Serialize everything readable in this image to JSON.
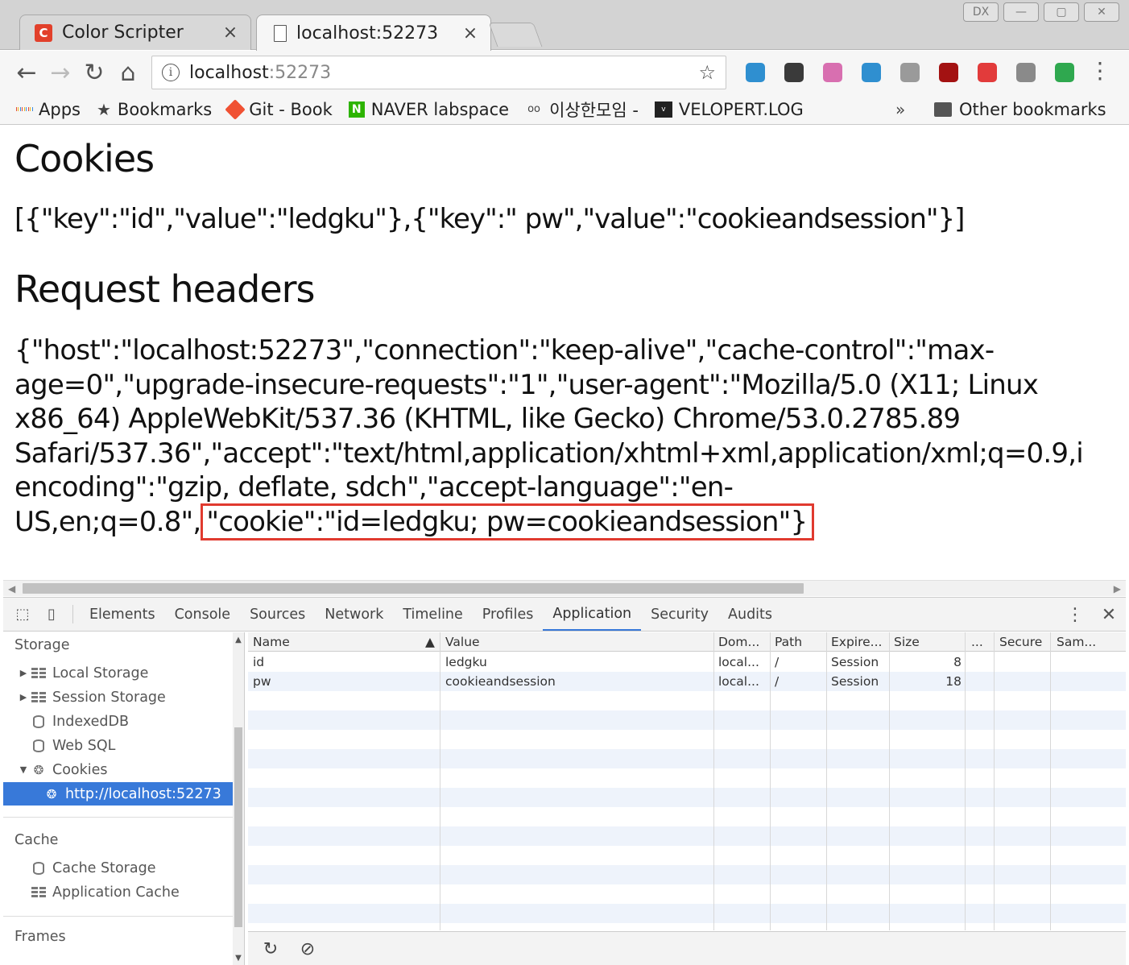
{
  "window": {
    "tabs": [
      {
        "title": "Color Scripter",
        "favicon": "C",
        "close": "×"
      },
      {
        "title": "localhost:52273",
        "close": "×"
      }
    ],
    "buttons": {
      "dx": "DX",
      "minimize": "—",
      "maximize": "▢",
      "close": "✕"
    }
  },
  "toolbar": {
    "url_host": "localhost",
    "url_port": ":52273",
    "back_icon": "←",
    "forward_icon": "→",
    "reload_icon": "↻",
    "home_icon": "⌂",
    "star_icon": "☆",
    "menu_icon": "⋮",
    "extensions": [
      {
        "name": "globe-extension",
        "color": "#2f8fd0"
      },
      {
        "name": "evernote-extension",
        "color": "#3a3a3a"
      },
      {
        "name": "gallery-extension",
        "color": "#d86fb0"
      },
      {
        "name": "globe2-extension",
        "color": "#2f8fd0"
      },
      {
        "name": "screen-extension",
        "color": "#9a9a9a"
      },
      {
        "name": "ublock-extension",
        "color": "#a31212"
      },
      {
        "name": "media-extension",
        "color": "#e23b3b"
      },
      {
        "name": "list-extension",
        "color": "#8a8a8a"
      },
      {
        "name": "green-circle-extension",
        "color": "#2fa84f"
      }
    ]
  },
  "bookmarks": {
    "items": [
      "Apps",
      "Bookmarks",
      "Git - Book",
      "NAVER labspace",
      "이상한모임 -",
      "VELOPERT.LOG"
    ],
    "naver_letter": "N",
    "velo_letter": "v",
    "more": "»",
    "other": "Other bookmarks"
  },
  "page": {
    "cookies_heading": "Cookies",
    "cookies_json": "[{\"key\":\"id\",\"value\":\"ledgku\"},{\"key\":\" pw\",\"value\":\"cookieandsession\"}]",
    "headers_heading": "Request headers",
    "headers_lines": [
      "{\"host\":\"localhost:52273\",\"connection\":\"keep-alive\",\"cache-control\":\"max-",
      "age=0\",\"upgrade-insecure-requests\":\"1\",\"user-agent\":\"Mozilla/5.0 (X11; Linux",
      "x86_64) AppleWebKit/537.36 (KHTML, like Gecko) Chrome/53.0.2785.89",
      "Safari/537.36\",\"accept\":\"text/html,application/xhtml+xml,application/xml;q=0.9,i",
      "encoding\":\"gzip, deflate, sdch\",\"accept-language\":\"en-"
    ],
    "headers_last_prefix": "US,en;q=0.8\",",
    "headers_highlight": "\"cookie\":\"id=ledgku; pw=cookieandsession\"}"
  },
  "devtools": {
    "tabs": [
      "Elements",
      "Console",
      "Sources",
      "Network",
      "Timeline",
      "Profiles",
      "Application",
      "Security",
      "Audits"
    ],
    "active_tab": "Application",
    "sidebar": {
      "storage_heading": "Storage",
      "local_storage": "Local Storage",
      "session_storage": "Session Storage",
      "indexeddb": "IndexedDB",
      "websql": "Web SQL",
      "cookies": "Cookies",
      "cookie_origin": "http://localhost:52273",
      "cache_heading": "Cache",
      "cache_storage": "Cache Storage",
      "app_cache": "Application Cache",
      "frames_heading": "Frames"
    },
    "columns": [
      "Name",
      "Value",
      "Dom...",
      "Path",
      "Expire...",
      "Size",
      "...",
      "Secure",
      "Sam..."
    ],
    "sort_icon": "▲",
    "rows": [
      {
        "name": "id",
        "value": "ledgku",
        "domain": "local...",
        "path": "/",
        "expires": "Session",
        "size": "8"
      },
      {
        "name": "pw",
        "value": "cookieandsession",
        "domain": "local...",
        "path": "/",
        "expires": "Session",
        "size": "18"
      }
    ],
    "footer": {
      "refresh_icon": "↻",
      "clear_icon": "⊘"
    }
  }
}
